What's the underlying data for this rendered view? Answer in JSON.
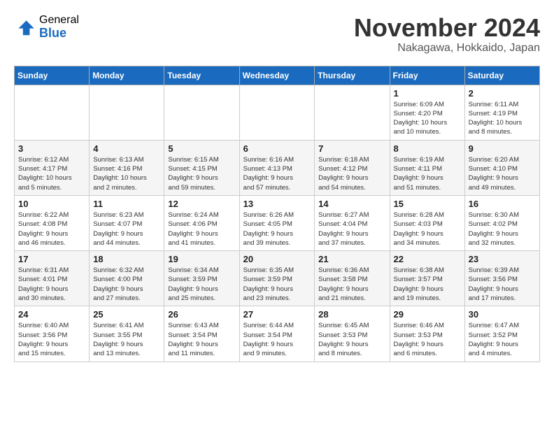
{
  "header": {
    "logo_general": "General",
    "logo_blue": "Blue",
    "month_title": "November 2024",
    "location": "Nakagawa, Hokkaido, Japan"
  },
  "weekdays": [
    "Sunday",
    "Monday",
    "Tuesday",
    "Wednesday",
    "Thursday",
    "Friday",
    "Saturday"
  ],
  "weeks": [
    [
      {
        "day": "",
        "info": ""
      },
      {
        "day": "",
        "info": ""
      },
      {
        "day": "",
        "info": ""
      },
      {
        "day": "",
        "info": ""
      },
      {
        "day": "",
        "info": ""
      },
      {
        "day": "1",
        "info": "Sunrise: 6:09 AM\nSunset: 4:20 PM\nDaylight: 10 hours\nand 10 minutes."
      },
      {
        "day": "2",
        "info": "Sunrise: 6:11 AM\nSunset: 4:19 PM\nDaylight: 10 hours\nand 8 minutes."
      }
    ],
    [
      {
        "day": "3",
        "info": "Sunrise: 6:12 AM\nSunset: 4:17 PM\nDaylight: 10 hours\nand 5 minutes."
      },
      {
        "day": "4",
        "info": "Sunrise: 6:13 AM\nSunset: 4:16 PM\nDaylight: 10 hours\nand 2 minutes."
      },
      {
        "day": "5",
        "info": "Sunrise: 6:15 AM\nSunset: 4:15 PM\nDaylight: 9 hours\nand 59 minutes."
      },
      {
        "day": "6",
        "info": "Sunrise: 6:16 AM\nSunset: 4:13 PM\nDaylight: 9 hours\nand 57 minutes."
      },
      {
        "day": "7",
        "info": "Sunrise: 6:18 AM\nSunset: 4:12 PM\nDaylight: 9 hours\nand 54 minutes."
      },
      {
        "day": "8",
        "info": "Sunrise: 6:19 AM\nSunset: 4:11 PM\nDaylight: 9 hours\nand 51 minutes."
      },
      {
        "day": "9",
        "info": "Sunrise: 6:20 AM\nSunset: 4:10 PM\nDaylight: 9 hours\nand 49 minutes."
      }
    ],
    [
      {
        "day": "10",
        "info": "Sunrise: 6:22 AM\nSunset: 4:08 PM\nDaylight: 9 hours\nand 46 minutes."
      },
      {
        "day": "11",
        "info": "Sunrise: 6:23 AM\nSunset: 4:07 PM\nDaylight: 9 hours\nand 44 minutes."
      },
      {
        "day": "12",
        "info": "Sunrise: 6:24 AM\nSunset: 4:06 PM\nDaylight: 9 hours\nand 41 minutes."
      },
      {
        "day": "13",
        "info": "Sunrise: 6:26 AM\nSunset: 4:05 PM\nDaylight: 9 hours\nand 39 minutes."
      },
      {
        "day": "14",
        "info": "Sunrise: 6:27 AM\nSunset: 4:04 PM\nDaylight: 9 hours\nand 37 minutes."
      },
      {
        "day": "15",
        "info": "Sunrise: 6:28 AM\nSunset: 4:03 PM\nDaylight: 9 hours\nand 34 minutes."
      },
      {
        "day": "16",
        "info": "Sunrise: 6:30 AM\nSunset: 4:02 PM\nDaylight: 9 hours\nand 32 minutes."
      }
    ],
    [
      {
        "day": "17",
        "info": "Sunrise: 6:31 AM\nSunset: 4:01 PM\nDaylight: 9 hours\nand 30 minutes."
      },
      {
        "day": "18",
        "info": "Sunrise: 6:32 AM\nSunset: 4:00 PM\nDaylight: 9 hours\nand 27 minutes."
      },
      {
        "day": "19",
        "info": "Sunrise: 6:34 AM\nSunset: 3:59 PM\nDaylight: 9 hours\nand 25 minutes."
      },
      {
        "day": "20",
        "info": "Sunrise: 6:35 AM\nSunset: 3:59 PM\nDaylight: 9 hours\nand 23 minutes."
      },
      {
        "day": "21",
        "info": "Sunrise: 6:36 AM\nSunset: 3:58 PM\nDaylight: 9 hours\nand 21 minutes."
      },
      {
        "day": "22",
        "info": "Sunrise: 6:38 AM\nSunset: 3:57 PM\nDaylight: 9 hours\nand 19 minutes."
      },
      {
        "day": "23",
        "info": "Sunrise: 6:39 AM\nSunset: 3:56 PM\nDaylight: 9 hours\nand 17 minutes."
      }
    ],
    [
      {
        "day": "24",
        "info": "Sunrise: 6:40 AM\nSunset: 3:56 PM\nDaylight: 9 hours\nand 15 minutes."
      },
      {
        "day": "25",
        "info": "Sunrise: 6:41 AM\nSunset: 3:55 PM\nDaylight: 9 hours\nand 13 minutes."
      },
      {
        "day": "26",
        "info": "Sunrise: 6:43 AM\nSunset: 3:54 PM\nDaylight: 9 hours\nand 11 minutes."
      },
      {
        "day": "27",
        "info": "Sunrise: 6:44 AM\nSunset: 3:54 PM\nDaylight: 9 hours\nand 9 minutes."
      },
      {
        "day": "28",
        "info": "Sunrise: 6:45 AM\nSunset: 3:53 PM\nDaylight: 9 hours\nand 8 minutes."
      },
      {
        "day": "29",
        "info": "Sunrise: 6:46 AM\nSunset: 3:53 PM\nDaylight: 9 hours\nand 6 minutes."
      },
      {
        "day": "30",
        "info": "Sunrise: 6:47 AM\nSunset: 3:52 PM\nDaylight: 9 hours\nand 4 minutes."
      }
    ]
  ]
}
